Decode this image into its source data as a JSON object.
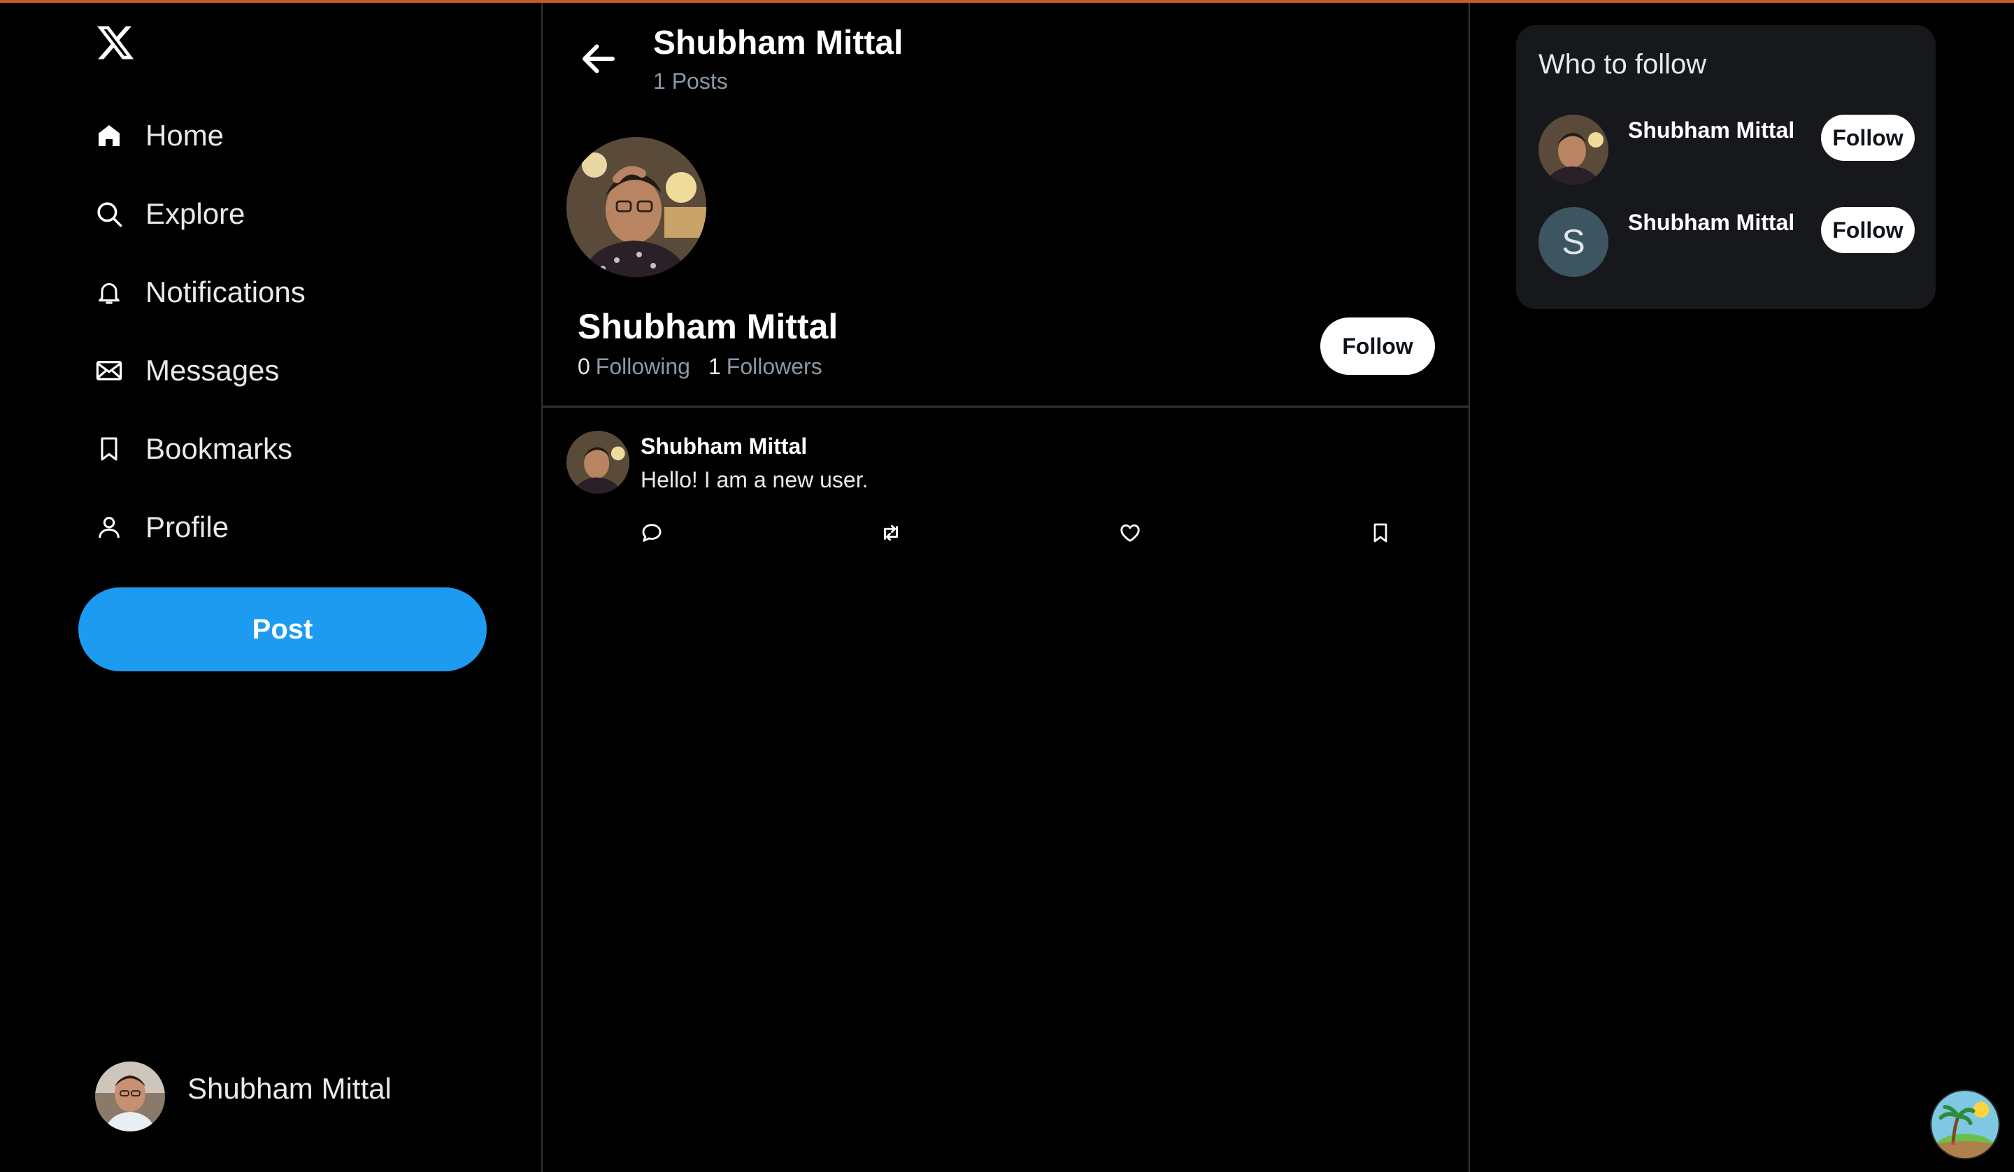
{
  "sidebar": {
    "logo": "x-logo",
    "items": [
      {
        "label": "Home",
        "icon": "home-icon"
      },
      {
        "label": "Explore",
        "icon": "search-icon"
      },
      {
        "label": "Notifications",
        "icon": "bell-icon"
      },
      {
        "label": "Messages",
        "icon": "mail-icon"
      },
      {
        "label": "Bookmarks",
        "icon": "bookmark-icon"
      },
      {
        "label": "Profile",
        "icon": "person-icon"
      }
    ],
    "post_label": "Post",
    "account_name": "Shubham Mittal"
  },
  "header": {
    "title": "Shubham Mittal",
    "subtitle": "1 Posts"
  },
  "profile": {
    "name": "Shubham Mittal",
    "following_count": "0",
    "following_label": "Following",
    "followers_count": "1",
    "followers_label": "Followers",
    "follow_label": "Follow"
  },
  "tweet": {
    "author": "Shubham Mittal",
    "text": "Hello! I am a new user."
  },
  "who_to_follow": {
    "title": "Who to follow",
    "users": [
      {
        "name": "Shubham Mittal",
        "follow_label": "Follow",
        "avatar": "photo"
      },
      {
        "name": "Shubham Mittal",
        "follow_label": "Follow",
        "avatar_letter": "S"
      }
    ]
  },
  "colors": {
    "accent": "#1d9bf0",
    "background": "#000000",
    "card": "#16181c",
    "muted_text": "#8b98a5",
    "top_border": "#c65a2e"
  }
}
